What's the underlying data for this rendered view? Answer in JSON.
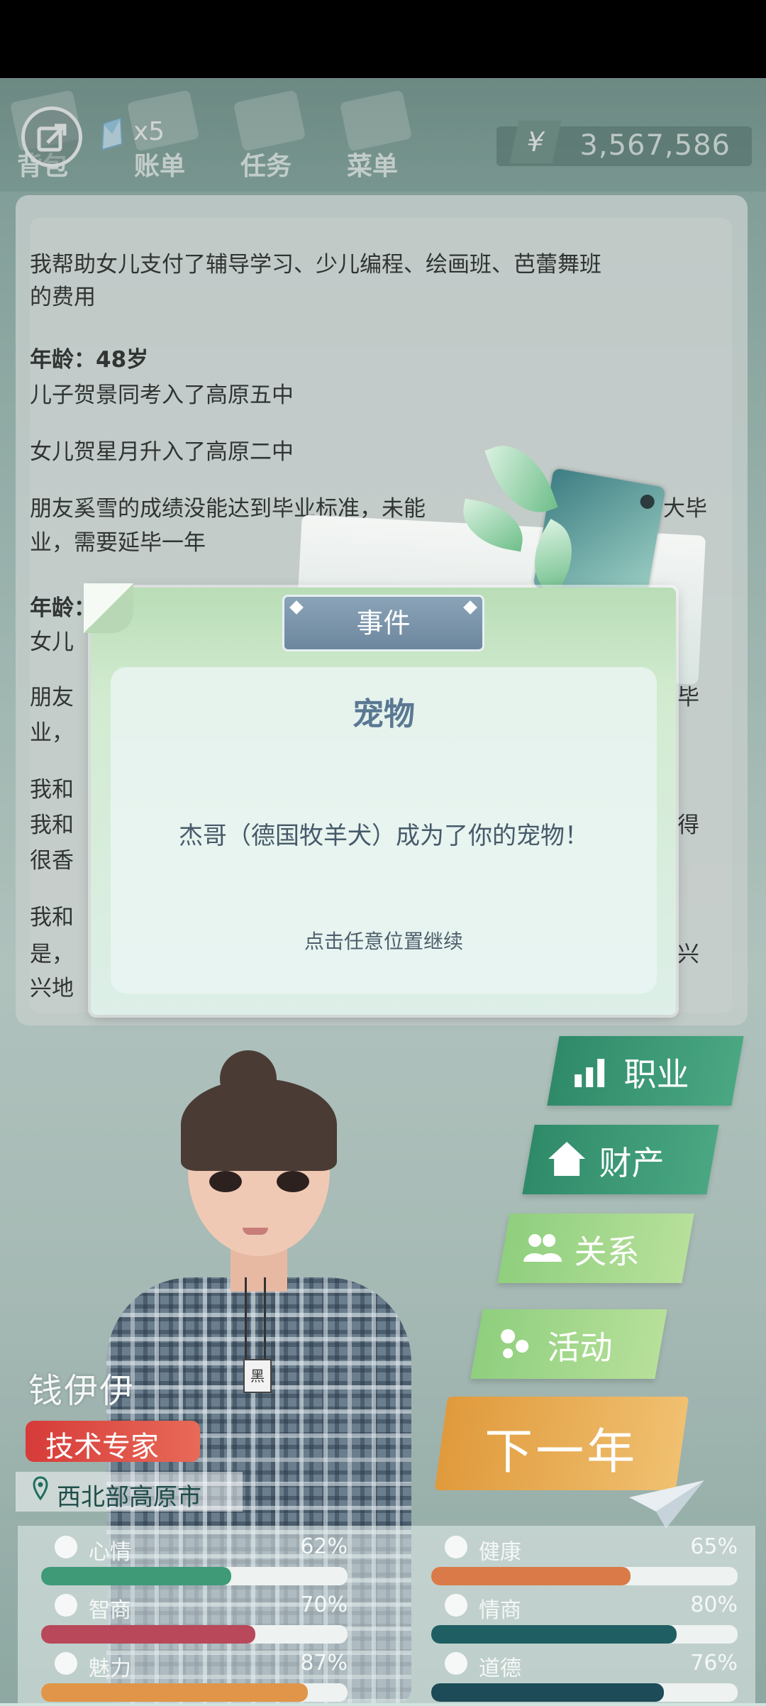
{
  "top_bar": {
    "gem_count": "x5",
    "nav": [
      {
        "label": "背包"
      },
      {
        "label": "账单"
      },
      {
        "label": "任务"
      },
      {
        "label": "菜单"
      }
    ],
    "currency_symbol": "¥",
    "money": "3,567,586"
  },
  "log": {
    "entries": [
      "我帮助女儿支付了辅导学习、少儿编程、绘画班、芭蕾舞班",
      "的费用",
      "年龄：48岁",
      "儿子贺景同考入了高原五中",
      "女儿贺星月升入了高原二中",
      "朋友奚雪的成绩没能达到毕业标准，未能",
      "大毕",
      "业，需要延毕一年",
      "年龄：",
      "女儿",
      "朋友",
      "毕",
      "业，",
      "我和",
      "我和",
      "得",
      "很香",
      "我和",
      "是，",
      "兴",
      "兴地"
    ]
  },
  "dialog": {
    "tab": "事件",
    "title": "宠物",
    "message": "杰哥（德国牧羊犬）成为了你的宠物！",
    "hint": "点击任意位置继续"
  },
  "character": {
    "name": "钱伊伊",
    "job": "技术专家",
    "location": "西北部高原市",
    "badge": "黑"
  },
  "menu": {
    "career": "职业",
    "property": "财产",
    "relations": "关系",
    "activity": "活动",
    "next_year": "下一年"
  },
  "stats": [
    {
      "label": "心情",
      "value": "62%",
      "pct": 62,
      "color": "#3f9a78",
      "icon": "smile-icon"
    },
    {
      "label": "健康",
      "value": "65%",
      "pct": 65,
      "color": "#d97a48",
      "icon": "heart-icon"
    },
    {
      "label": "智商",
      "value": "70%",
      "pct": 70,
      "color": "#b8485a",
      "icon": "bulb-icon"
    },
    {
      "label": "情商",
      "value": "80%",
      "pct": 80,
      "color": "#1f5f63",
      "icon": "apple-icon"
    },
    {
      "label": "魅力",
      "value": "87%",
      "pct": 87,
      "color": "#e09548",
      "icon": "sparkle-icon"
    },
    {
      "label": "道德",
      "value": "76%",
      "pct": 76,
      "color": "#1d4b57",
      "icon": "scale-icon"
    }
  ]
}
